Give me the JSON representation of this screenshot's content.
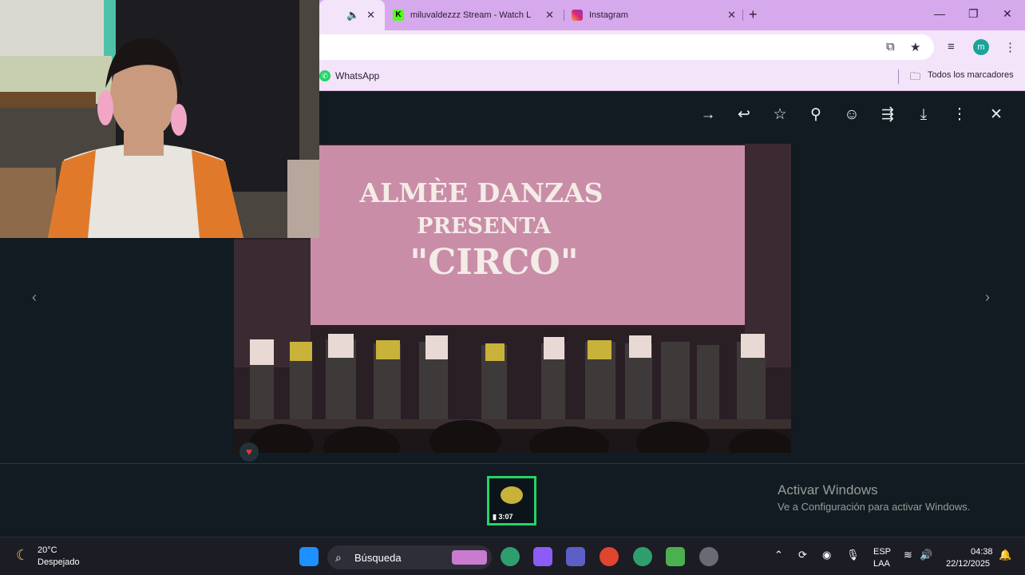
{
  "browser": {
    "tabs": [
      {
        "title": "",
        "close": "✕",
        "audio_icon": "speaker-icon"
      },
      {
        "title": "miluvaldezzz Stream - Watch L",
        "close": "✕"
      },
      {
        "title": "Instagram",
        "close": "✕"
      }
    ],
    "new_tab": "+",
    "window_controls": {
      "minimize": "—",
      "restore": "❐",
      "close": "✕"
    },
    "profile_initial": "m",
    "bookmarks": {
      "whatsapp": "WhatsApp",
      "all": "Todos los marcadores"
    }
  },
  "viewer": {
    "toolbar": [
      "arrow-right-icon",
      "reply-icon",
      "star-icon",
      "pin-icon",
      "emoji-icon",
      "forward-icon",
      "download-icon",
      "more-icon",
      "close-icon"
    ],
    "slide_text": {
      "line1": "ALMÈE DANZAS",
      "line2": "PRESENTA",
      "line3": "\"CIRCO\""
    },
    "reaction": "♥",
    "thumbnail_duration": "3:07",
    "prev": "‹",
    "next": "›"
  },
  "watermark": {
    "title": "Activar Windows",
    "subtitle": "Ve a Configuración para activar Windows."
  },
  "taskbar": {
    "weather_temp": "20°C",
    "weather_desc": "Despejado",
    "search_label": "Búsqueda",
    "lang1": "ESP",
    "lang2": "LAA",
    "time": "04:38",
    "date": "22/12/2025"
  }
}
